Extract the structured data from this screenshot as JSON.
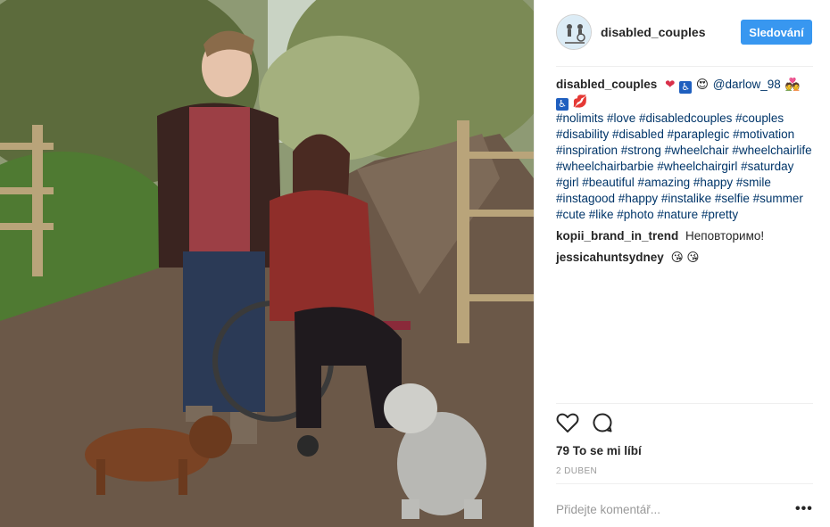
{
  "post": {
    "photo_alt": "Young couple on a country path with two dogs",
    "author": "disabled_couples",
    "follow_label": "Sledování",
    "avatar_text": "NO LIMITS"
  },
  "comments": [
    {
      "user": "disabled_couples",
      "emojis_before": [
        "❤",
        "♿",
        "😍"
      ],
      "mention": "@darlow_98",
      "emojis_after": [
        "💑",
        "♿",
        "💋"
      ],
      "hashtags": "#nolimits #love #disabledcouples #couples #disability #disabled #paraplegic #motivation #inspiration #strong #wheelchair #wheelchairlife #wheelchairbarbie #wheelchairgirl #saturday #girl #beautiful #amazing #happy #smile #instagood #happy #instalike #selfie #summer #cute #like #photo #nature #pretty"
    },
    {
      "user": "kopii_brand_in_trend",
      "text": "Неповторимо!"
    },
    {
      "user": "jessicahuntsydney",
      "text": "😘 😘"
    }
  ],
  "actions": {
    "like_icon": "heart-icon",
    "comment_icon": "comment-bubble-icon"
  },
  "likes_text": "79 To se mi líbí",
  "date_text": "2 DUBEN",
  "add_comment_placeholder": "Přidejte komentář...",
  "more_label": "•••",
  "colors": {
    "accent": "#3897f0",
    "link": "#003569",
    "muted": "#999999"
  }
}
